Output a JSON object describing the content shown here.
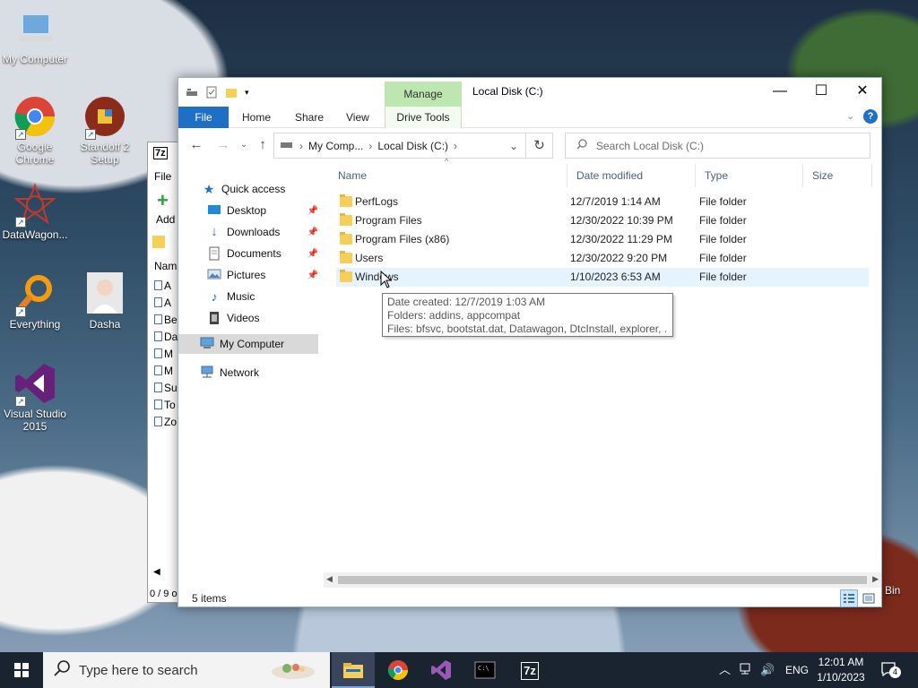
{
  "desktop": {
    "icons": [
      {
        "label": "My Computer"
      },
      {
        "label": "Google Chrome"
      },
      {
        "label": "Standoff 2 Setup"
      },
      {
        "label": "DataWagon..."
      },
      {
        "label": "Everything"
      },
      {
        "label": "Dasha"
      },
      {
        "label": "Visual Studio 2015"
      }
    ],
    "recycle_partial": "Bin"
  },
  "bg_window": {
    "title_partial": "7z",
    "menu_file": "File",
    "add_label": "Add",
    "col_name": "Nam",
    "rows": [
      "A",
      "A",
      "Be",
      "Da",
      "M",
      "M",
      "Su",
      "To",
      "Zo"
    ],
    "status_partial": "0 / 9 o"
  },
  "explorer": {
    "title": "Local Disk (C:)",
    "manage_label": "Manage",
    "ribbon_tabs": {
      "file": "File",
      "home": "Home",
      "share": "Share",
      "view": "View",
      "drive_tools": "Drive Tools"
    },
    "address": {
      "crumb1": "My Comp...",
      "crumb2": "Local Disk (C:)"
    },
    "search_placeholder": "Search Local Disk (C:)",
    "nav": {
      "quick_access": "Quick access",
      "desktop": "Desktop",
      "downloads": "Downloads",
      "documents": "Documents",
      "pictures": "Pictures",
      "music": "Music",
      "videos": "Videos",
      "my_computer": "My Computer",
      "network": "Network"
    },
    "columns": {
      "name": "Name",
      "date": "Date modified",
      "type": "Type",
      "size": "Size"
    },
    "files": [
      {
        "name": "PerfLogs",
        "date": "12/7/2019 1:14 AM",
        "type": "File folder"
      },
      {
        "name": "Program Files",
        "date": "12/30/2022 10:39 PM",
        "type": "File folder"
      },
      {
        "name": "Program Files (x86)",
        "date": "12/30/2022 11:29 PM",
        "type": "File folder"
      },
      {
        "name": "Users",
        "date": "12/30/2022 9:20 PM",
        "type": "File folder"
      },
      {
        "name": "Windows",
        "date": "1/10/2023 6:53 AM",
        "type": "File folder"
      }
    ],
    "tooltip": {
      "line1": "Date created: 12/7/2019 1:03 AM",
      "line2": "Folders: addins, appcompat",
      "line3": "Files: bfsvc, bootstat.dat, Datawagon, DtcInstall, explorer, ..."
    },
    "status": "5 items"
  },
  "taskbar": {
    "search_placeholder": "Type here to search",
    "lang": "ENG",
    "time": "12:01 AM",
    "date": "1/10/2023",
    "notifications": "4",
    "zip_label": "7z"
  },
  "colors": {
    "accent": "#1f6fc5",
    "manage": "#bde6b0",
    "hover_row": "#e5f3ff",
    "folder": "#f5cf58"
  }
}
